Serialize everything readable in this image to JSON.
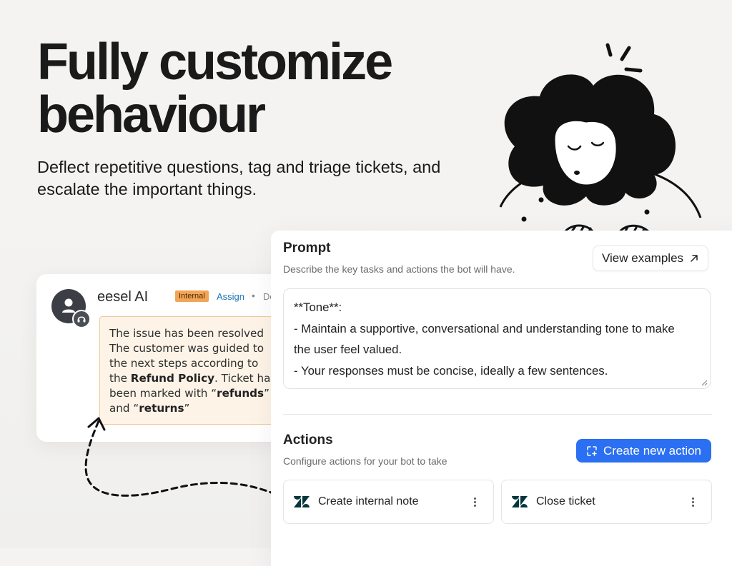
{
  "hero": {
    "title": "Fully customize behaviour",
    "subtitle": "Deflect repetitive questions, tag and triage tickets, and escalate the important things."
  },
  "ticket": {
    "agent_name": "eesel AI",
    "badge": "Internal",
    "assign_label": "Assign",
    "separator": "•",
    "meta_truncated": "De",
    "avatar_icon": "user-icon",
    "avatar_badge_icon": "headset-icon",
    "note": {
      "line1": "The issue has been resolved",
      "line2": "The customer was guided to",
      "line3": "the next steps according to",
      "line4_prefix": "the ",
      "line4_bold": "Refund Policy",
      "line4_suffix": ". Ticket ha",
      "line5_prefix": "been marked with “",
      "line5_bold": "refunds",
      "line5_suffix": "”",
      "line6_prefix": "and “",
      "line6_bold": "returns",
      "line6_suffix": "”"
    }
  },
  "prompt_section": {
    "title": "Prompt",
    "description": "Describe the key tasks and actions the bot will have.",
    "view_examples_label": "View examples",
    "view_examples_icon": "arrow-up-right-icon",
    "text_lines": [
      "**Tone**:",
      "- Maintain a supportive, conversational and understanding tone to make",
      "the user feel valued.",
      "- Your responses must be concise, ideally a few sentences."
    ]
  },
  "actions_section": {
    "title": "Actions",
    "description": "Configure actions for your bot to take",
    "create_label": "Create new action",
    "create_icon": "add-action-icon",
    "items": [
      {
        "label": "Create internal note",
        "icon": "zendesk-icon"
      },
      {
        "label": "Close ticket",
        "icon": "zendesk-icon"
      }
    ]
  },
  "colors": {
    "accent_blue": "#2b6ff2",
    "badge_orange": "#f2a556",
    "note_background": "#fdf3e7",
    "link_blue": "#1f73b7"
  }
}
